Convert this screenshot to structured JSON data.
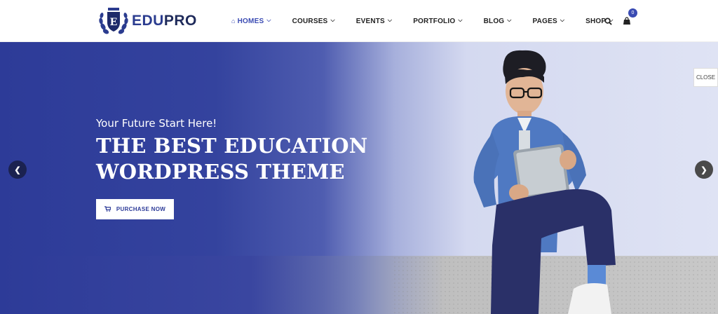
{
  "brand": {
    "name_part1": "EDU",
    "name_part2": "PRO",
    "emblem_letter": "E"
  },
  "nav": {
    "items": [
      {
        "label": "HOMES",
        "active": true
      },
      {
        "label": "COURSES"
      },
      {
        "label": "EVENTS"
      },
      {
        "label": "PORTFOLIO"
      },
      {
        "label": "BLOG"
      },
      {
        "label": "PAGES"
      },
      {
        "label": "SHOP"
      }
    ],
    "cart_count": "0"
  },
  "hero": {
    "tagline": "Your Future Start Here!",
    "headline_line1": "THE BEST EDUCATION",
    "headline_line2": "WORDPRESS THEME",
    "cta_label": "PURCHASE NOW"
  },
  "panel": {
    "close_label": "CLOSE"
  },
  "colors": {
    "accent": "#3a4bb3",
    "hero_blue": "#2d3b98"
  }
}
